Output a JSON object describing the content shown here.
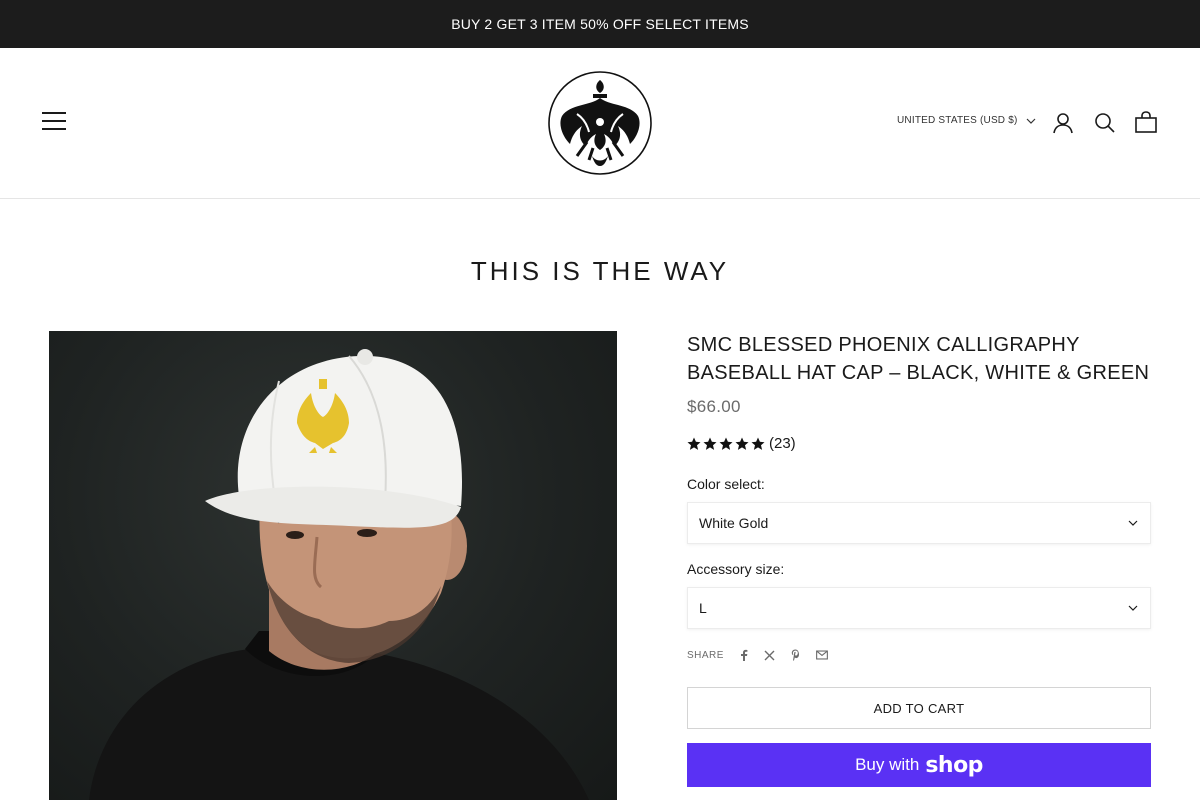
{
  "announcement": {
    "text": "BUY 2 GET 3 ITEM 50% OFF SELECT ITEMS"
  },
  "header": {
    "region_label": "UNITED STATES (USD $)",
    "icons": [
      "menu-icon",
      "account-icon",
      "search-icon",
      "cart-icon",
      "brand-logo"
    ]
  },
  "page": {
    "title": "THIS IS THE WAY"
  },
  "product": {
    "title": "SMC BLESSED PHOENIX CALLIGRAPHY BASEBALL HAT CAP – BLACK, WHITE & GREEN",
    "price": "$66.00",
    "rating": {
      "stars": 5,
      "count_label": "(23)"
    },
    "color_label": "Color select:",
    "color_value": "White Gold",
    "size_label": "Accessory size:",
    "size_value": "L",
    "share_label": "SHARE",
    "share_icons": [
      "facebook-icon",
      "x-icon",
      "pinterest-icon",
      "email-icon"
    ],
    "add_to_cart": "ADD TO CART",
    "buy_with": "Buy with",
    "shop_word": "shop"
  },
  "colors": {
    "announce_bg": "#1c1c1c",
    "shop_pay": "#5a31f4",
    "price": "#6b6b6b"
  }
}
